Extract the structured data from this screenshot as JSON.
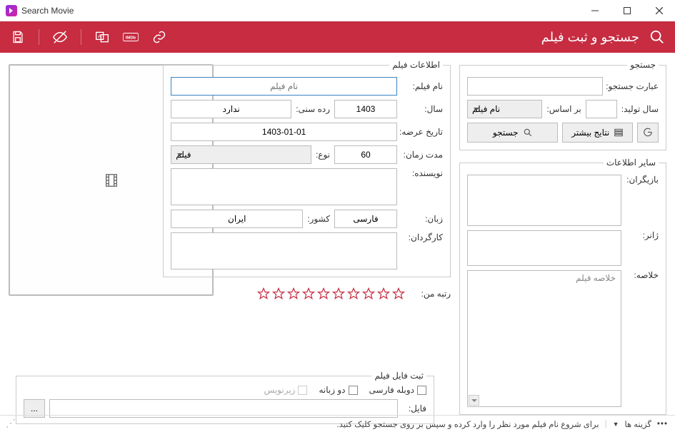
{
  "window": {
    "title": "Search Movie"
  },
  "ribbon": {
    "title": "جستجو و ثبت فیلم"
  },
  "search": {
    "legend": "جستجو",
    "term_label": "عبارت جستجو:",
    "term_value": "",
    "year_label": "سال تولید:",
    "year_value": "",
    "by_label": "بر اساس:",
    "by_value": "نام فیلم",
    "search_btn": "جستجو",
    "more_btn": "نتایج بیشتر"
  },
  "other": {
    "legend": "سایر اطلاعات",
    "actors_label": "بازیگران:",
    "genre_label": "ژانر:",
    "summary_label": "خلاصه:",
    "summary_placeholder": "خلاصه فیلم"
  },
  "movie": {
    "legend": "اطلاعات فیلم",
    "name_label": "نام فیلم:",
    "name_placeholder": "نام فیلم",
    "year_label": "سال:",
    "year_value": "1403",
    "age_label": "رده سنی:",
    "age_value": "ندارد",
    "release_label": "تاریخ عرضه:",
    "release_value": "1403-01-01",
    "runtime_label": "مدت زمان:",
    "runtime_value": "60",
    "type_label": "نوع:",
    "type_value": "فیلم",
    "writer_label": "نویسنده:",
    "lang_label": "زبان:",
    "lang_value": "فارسی",
    "country_label": "کشور:",
    "country_value": "ایران",
    "director_label": "کارگردان:"
  },
  "rating": {
    "label": "رتبه من:"
  },
  "file": {
    "legend": "ثبت فایل فیلم",
    "dub_label": "دوبله فارسی",
    "dual_label": "دو زبانه",
    "sub_label": "زیرنویس",
    "path_label": "فایل:",
    "path_value": "",
    "browse": "..."
  },
  "status": {
    "options": "گزینه ها",
    "hint": "برای شروع نام فیلم مورد نظر را وارد کرده و سپس بر روی جستجو کلیک کنید."
  }
}
